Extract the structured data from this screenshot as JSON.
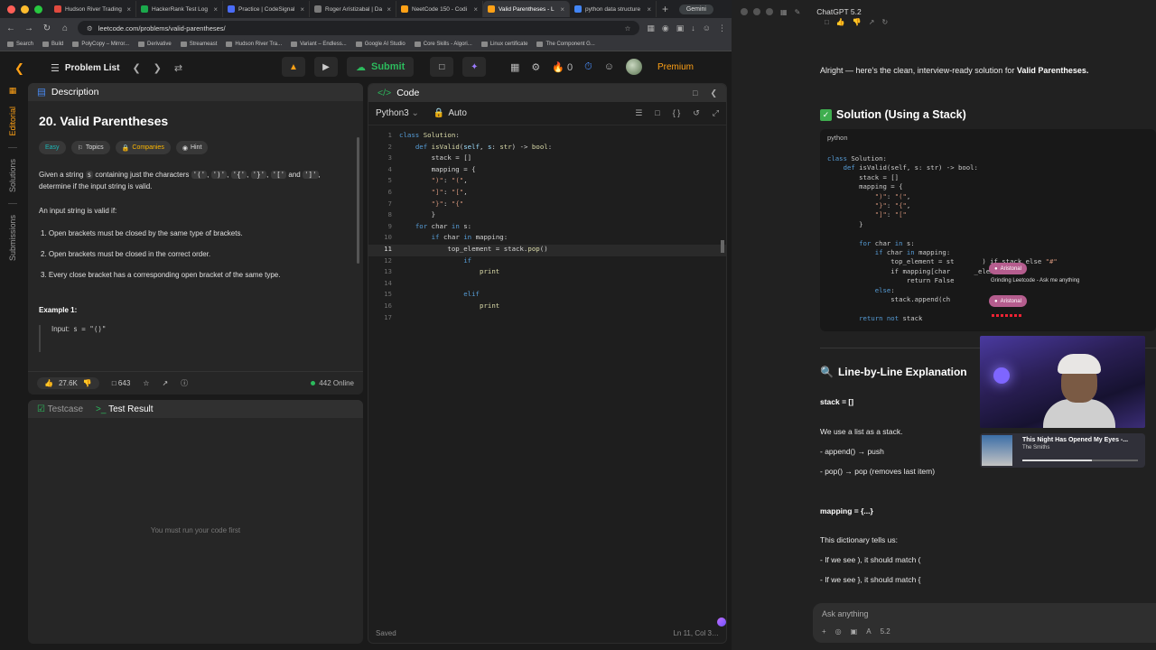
{
  "browser": {
    "tabs": [
      {
        "label": "Hudson River Trading",
        "color": "#e04a3f"
      },
      {
        "label": "HackerRank Test Log",
        "color": "#1ba94c"
      },
      {
        "label": "Practice | CodeSignal",
        "color": "#4a6cf7"
      },
      {
        "label": "Roger Arístizabal | Da",
        "color": "#7a7a7a"
      },
      {
        "label": "NeetCode 150 - Codi",
        "color": "#ffa116"
      },
      {
        "label": "Valid Parentheses - L",
        "color": "#ffa116",
        "active": true
      },
      {
        "label": "python data structure",
        "color": "#4285f4"
      }
    ],
    "gemini_label": "Gemini",
    "url": "leetcode.com/problems/valid-parentheses/",
    "bookmarks": [
      "Search",
      "Build",
      "PolyCopy – Mirror...",
      "Derivative",
      "Streameast",
      "Hudson River Tra...",
      "Variant – Endless...",
      "Google AI Studio",
      "Core Skills - Algori...",
      "Linux certificate",
      "The Component G..."
    ]
  },
  "leetcode": {
    "problem_list": "Problem List",
    "submit": "Submit",
    "streak": "0",
    "premium": "Premium",
    "rail": [
      "Editorial",
      "Solutions",
      "Submissions"
    ],
    "description": {
      "tab": "Description",
      "title": "20. Valid Parentheses",
      "chips": [
        "Easy",
        "Topics",
        "Companies",
        "Hint"
      ],
      "p1a": "Given a string ",
      "p1s": "s",
      "p1b": " containing just the characters ",
      "c1": "'('",
      "c2": "')'",
      "c3": "'{'",
      "c4": "'}'",
      "c5": "'['",
      "and": " and",
      "c6": "']'",
      "p1c": ", determine if the input string is valid.",
      "p2": "An input string is valid if:",
      "rules": [
        "1. Open brackets must be closed by the same type of brackets.",
        "2. Open brackets must be closed in the correct order.",
        "3. Every close bracket has a corresponding open bracket of the same type."
      ],
      "example_heading": "Example 1:",
      "example_input_label": "Input: ",
      "example_input_value": "s = \"()\"",
      "likes": "27.6K",
      "comments": "643",
      "online": "442 Online"
    },
    "testcase": {
      "tab1": "Testcase",
      "tab2": "Test Result",
      "empty": "You must run your code first"
    },
    "code": {
      "tab": "Code",
      "language": "Python3",
      "mode": "Auto",
      "status": "Saved",
      "position": "Ln 11, Col 3…"
    }
  },
  "chat": {
    "model": "ChatGPT 5.2",
    "intro": "Alright — here's the clean, interview-ready solution for ",
    "intro_bold": "Valid Parentheses.",
    "solution_heading": "Solution (Using a Stack)",
    "code_lang": "python",
    "explain_heading": "Line-by-Line Explanation",
    "lines": [
      {
        "text": "stack = []",
        "bold": true
      },
      {
        "text": "We use a list as a stack.",
        "bold": false
      },
      {
        "text": "- append() → push",
        "bold": false
      },
      {
        "text": "- pop() → pop (removes last item)",
        "bold": false
      },
      {
        "text": "mapping = {...}",
        "bold": true
      },
      {
        "text": "This dictionary tells us:",
        "bold": false
      },
      {
        "text": "- If we see ), it should match (",
        "bold": false
      },
      {
        "text": "- If we see }, it should match {",
        "bold": false
      }
    ],
    "ask_placeholder": "Ask anything",
    "model_chip": "5.2"
  },
  "overlay": {
    "chip_name": "Aristonal",
    "notif_text": "Grinding Leetcode - Ask me anything",
    "song_title": "This Night Has Opened My Eyes -...",
    "song_artist": "The Smiths"
  }
}
